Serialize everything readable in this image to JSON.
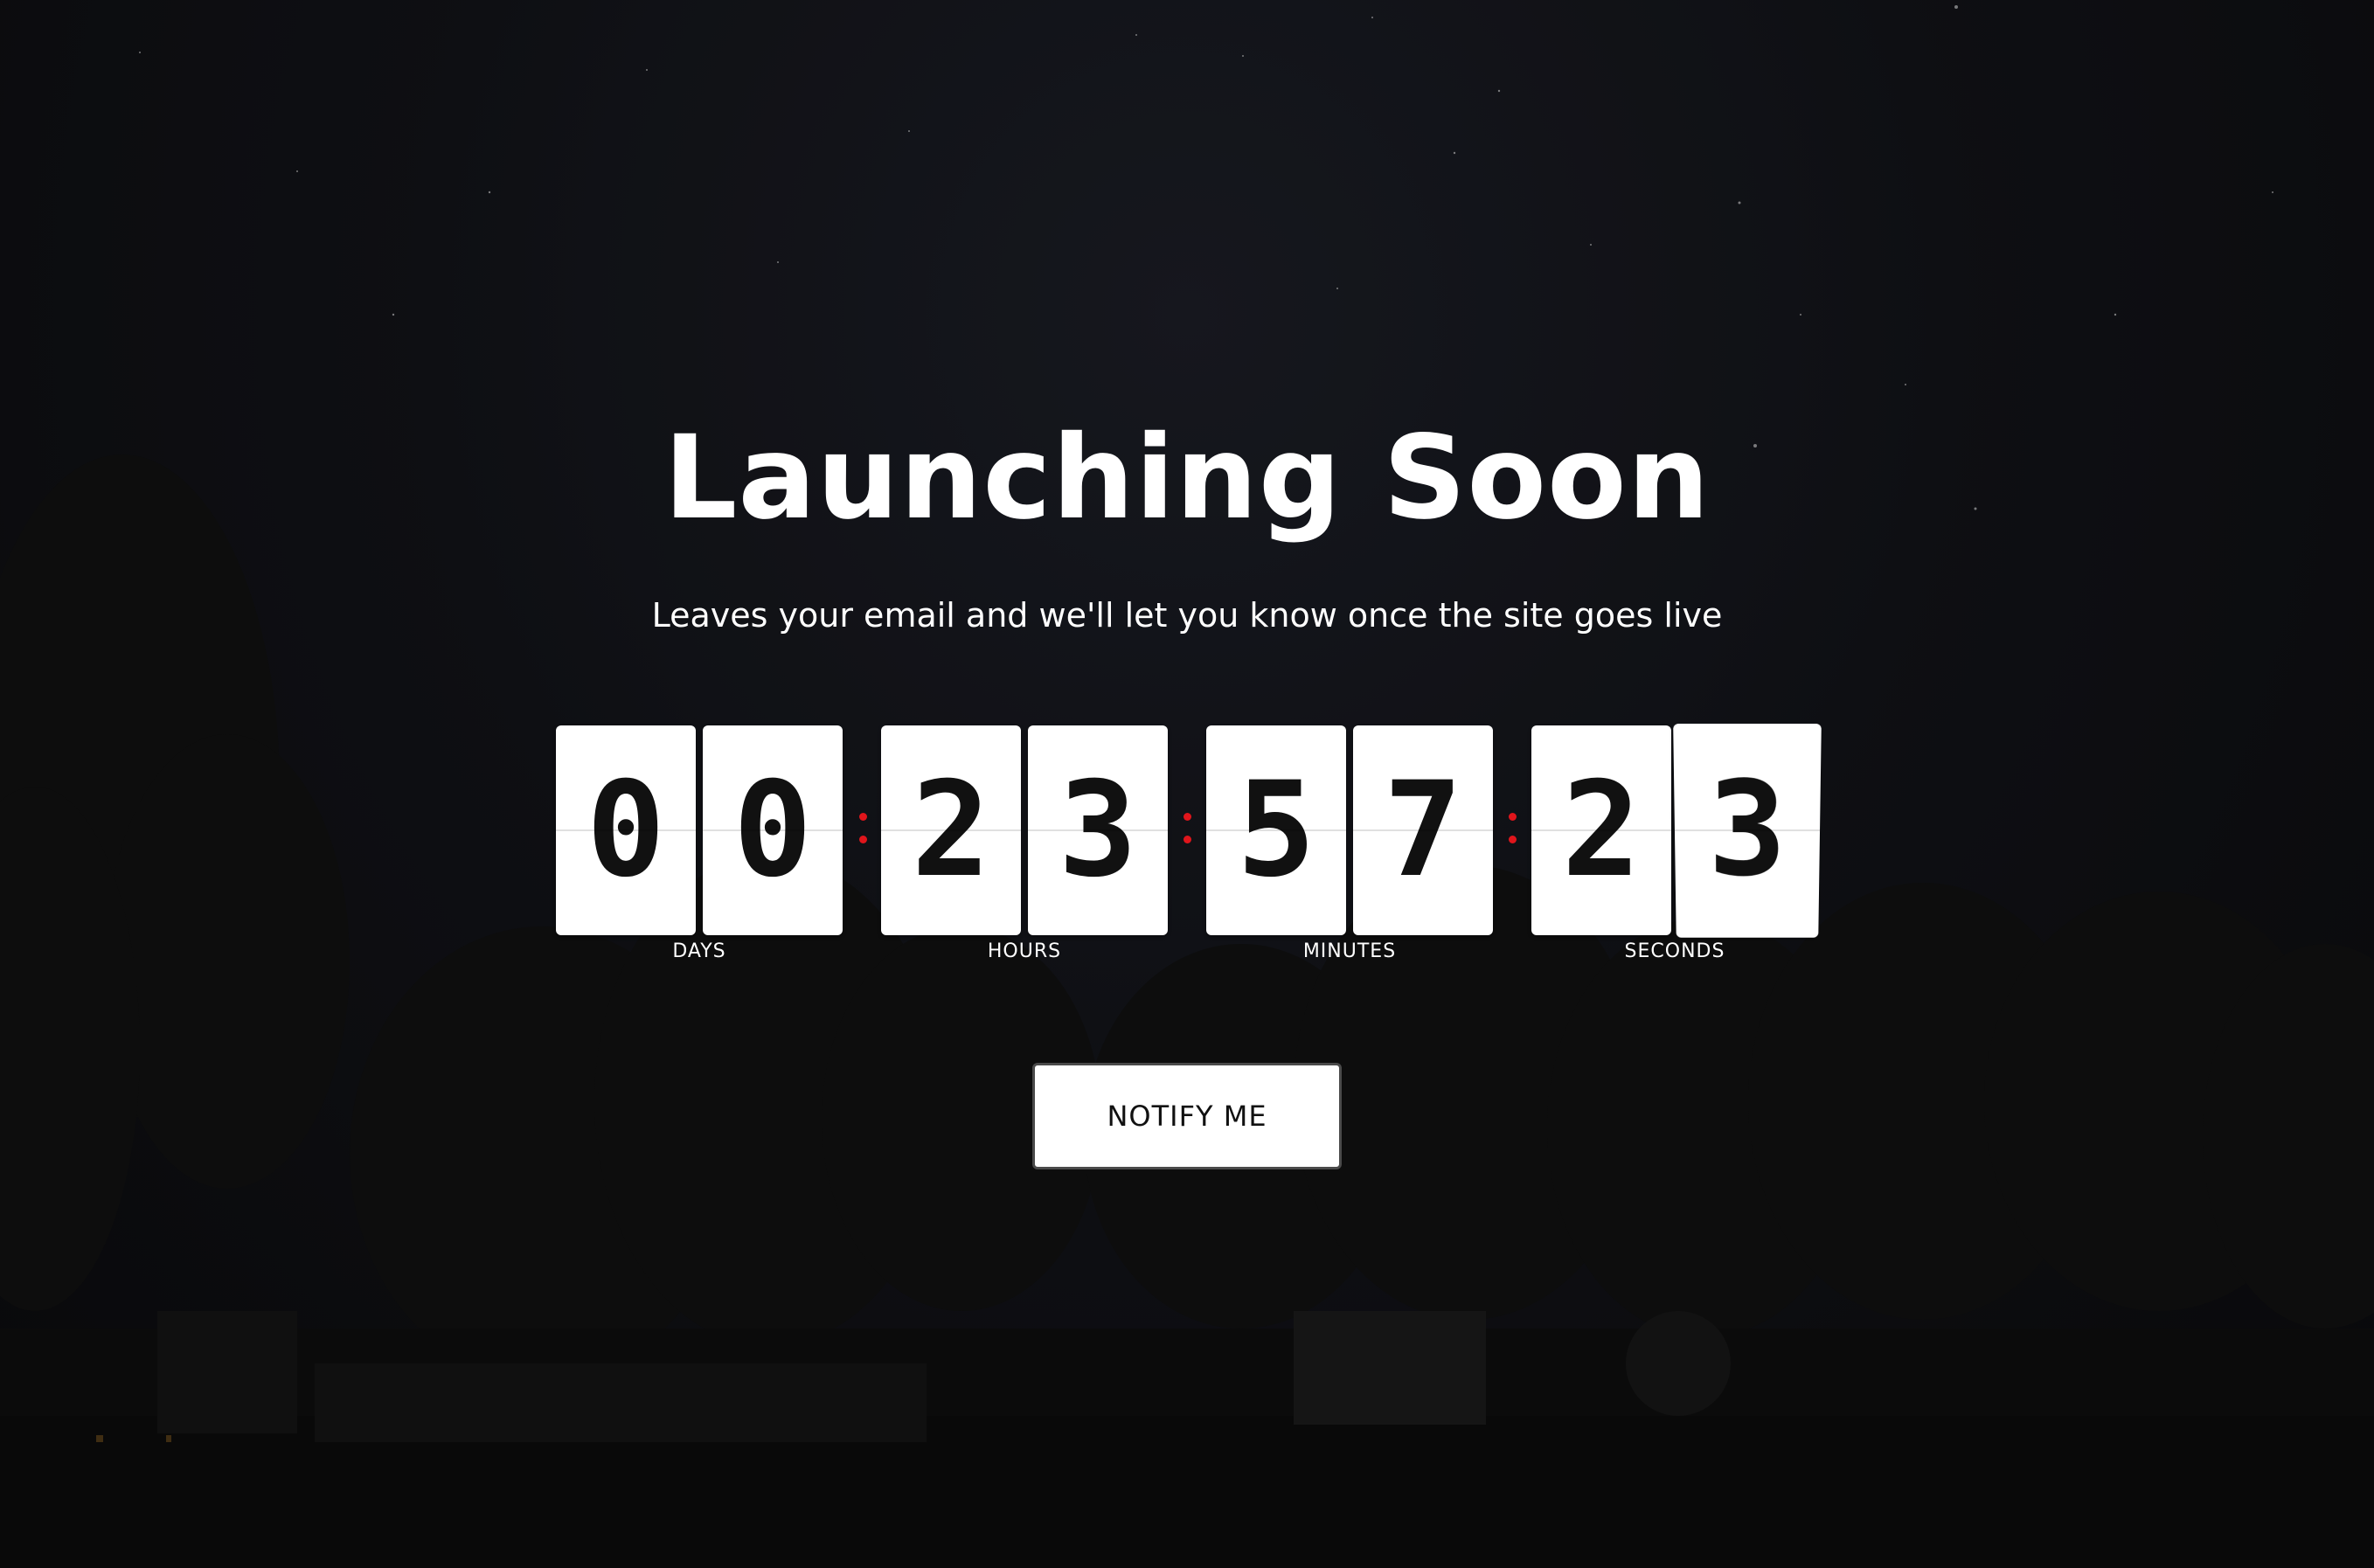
{
  "page": {
    "title": "Launching Soon",
    "subtitle": "Leaves your email and we'll let you know once the site goes live"
  },
  "countdown": {
    "days": [
      "0",
      "0"
    ],
    "hours": [
      "2",
      "3"
    ],
    "minutes": [
      "5",
      "7"
    ],
    "seconds": [
      "2",
      "3"
    ],
    "labels": {
      "days": "DAYS",
      "hours": "HOURS",
      "minutes": "MINUTES",
      "seconds": "SECONDS"
    },
    "separator_color": "#e0151b"
  },
  "cta": {
    "notify_label": "NOTIFY ME"
  },
  "colors": {
    "background": "#0d0d0f",
    "text": "#ffffff",
    "card": "#ffffff",
    "digit": "#111111"
  }
}
